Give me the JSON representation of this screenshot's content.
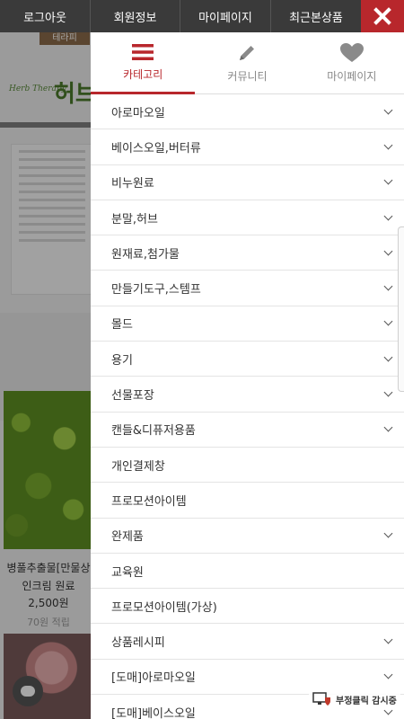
{
  "topbar": {
    "items": [
      "로그아웃",
      "회원정보",
      "마이페이지",
      "최근본상품"
    ]
  },
  "menu": {
    "tabs": [
      {
        "label": "카테고리",
        "icon": "hamburger-icon",
        "active": true
      },
      {
        "label": "커뮤니티",
        "icon": "pencil-icon",
        "active": false
      },
      {
        "label": "마이페이지",
        "icon": "heart-icon",
        "active": false
      }
    ],
    "items": [
      {
        "label": "아로마오일",
        "expandable": true
      },
      {
        "label": "베이스오일,버터류",
        "expandable": true
      },
      {
        "label": "비누원료",
        "expandable": true
      },
      {
        "label": "분말,허브",
        "expandable": true
      },
      {
        "label": "원재료,첨가물",
        "expandable": true
      },
      {
        "label": "만들기도구,스템프",
        "expandable": true
      },
      {
        "label": "몰드",
        "expandable": true
      },
      {
        "label": "용기",
        "expandable": true
      },
      {
        "label": "선물포장",
        "expandable": true
      },
      {
        "label": "캔들&디퓨저용품",
        "expandable": true
      },
      {
        "label": "개인결제창",
        "expandable": false
      },
      {
        "label": "프로모션아이템",
        "expandable": false
      },
      {
        "label": "완제품",
        "expandable": true
      },
      {
        "label": "교육원",
        "expandable": false
      },
      {
        "label": "프로모션아이템(가상)",
        "expandable": false
      },
      {
        "label": "상품레시피",
        "expandable": true
      },
      {
        "label": "[도매]아로마오일",
        "expandable": true
      },
      {
        "label": "[도매]베이스오일",
        "expandable": true
      }
    ]
  },
  "background": {
    "logo": "테라피",
    "brand_small": "Herb Therapy",
    "brand_big": "허브",
    "product_name": "병풀추출물[만물상 인크림 원료",
    "price": "2,500원",
    "points": "70원 적립"
  },
  "badge": {
    "label": "부정클릭 감시중"
  },
  "colors": {
    "accent": "#b8272c",
    "topbar": "#3a3a3a"
  }
}
